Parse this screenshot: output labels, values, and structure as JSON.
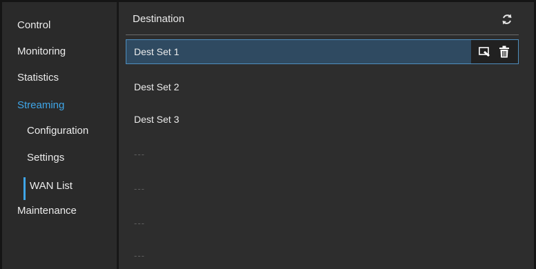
{
  "sidebar": {
    "items": [
      {
        "label": "Control"
      },
      {
        "label": "Monitoring"
      },
      {
        "label": "Statistics"
      },
      {
        "label": "Streaming"
      },
      {
        "label": "Configuration"
      },
      {
        "label": "Settings"
      },
      {
        "label": "WAN List"
      },
      {
        "label": "Maintenance"
      }
    ],
    "active_item": "Streaming",
    "selected_subitem": "WAN List"
  },
  "main": {
    "title": "Destination",
    "rows": [
      {
        "label": "Dest Set 1"
      },
      {
        "label": "Dest Set 2"
      },
      {
        "label": "Dest Set 3"
      },
      {
        "label": "---"
      },
      {
        "label": "---"
      },
      {
        "label": "---"
      },
      {
        "label": "---"
      }
    ],
    "selected_row": "Dest Set 1",
    "row_actions": {
      "edit_icon": "edit-icon",
      "delete_icon": "trash-icon"
    },
    "refresh_icon": "refresh-icon"
  },
  "colors": {
    "accent": "#3fa6e8",
    "sidebar_bg": "#2a2a2a",
    "panel_bg": "#2d2d2d",
    "selected_row_bg": "#2f4a61",
    "selected_row_border": "#4f8fc0"
  }
}
